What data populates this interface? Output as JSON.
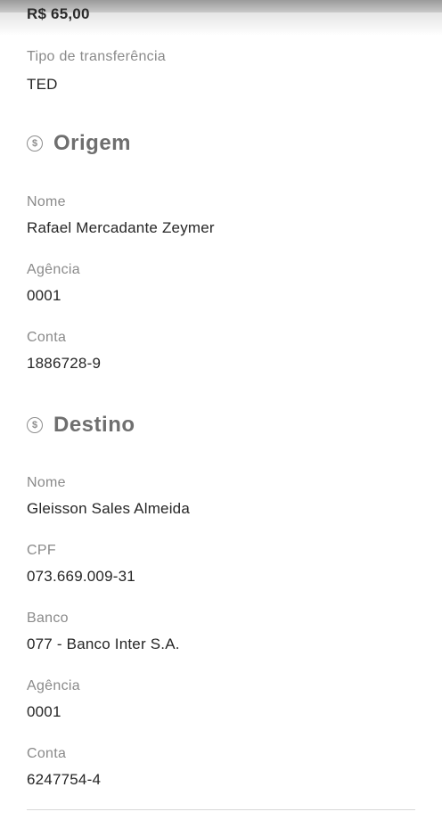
{
  "transfer": {
    "amount": "R$ 65,00",
    "type_label": "Tipo de transferência",
    "type_value": "TED"
  },
  "origem": {
    "title": "Origem",
    "icon": "dollar-circle-icon",
    "nome_label": "Nome",
    "nome_value": "Rafael Mercadante Zeymer",
    "agencia_label": "Agência",
    "agencia_value": "0001",
    "conta_label": "Conta",
    "conta_value": "1886728-9"
  },
  "destino": {
    "title": "Destino",
    "icon": "dollar-circle-icon",
    "nome_label": "Nome",
    "nome_value": "Gleisson Sales Almeida",
    "cpf_label": "CPF",
    "cpf_value": "073.669.009-31",
    "banco_label": "Banco",
    "banco_value": "077 - Banco Inter S.A.",
    "agencia_label": "Agência",
    "agencia_value": "0001",
    "conta_label": "Conta",
    "conta_value": "6247754-4"
  },
  "colors": {
    "label": "#8a8a8a",
    "value": "#262626",
    "section_title": "#6f6f6f"
  }
}
